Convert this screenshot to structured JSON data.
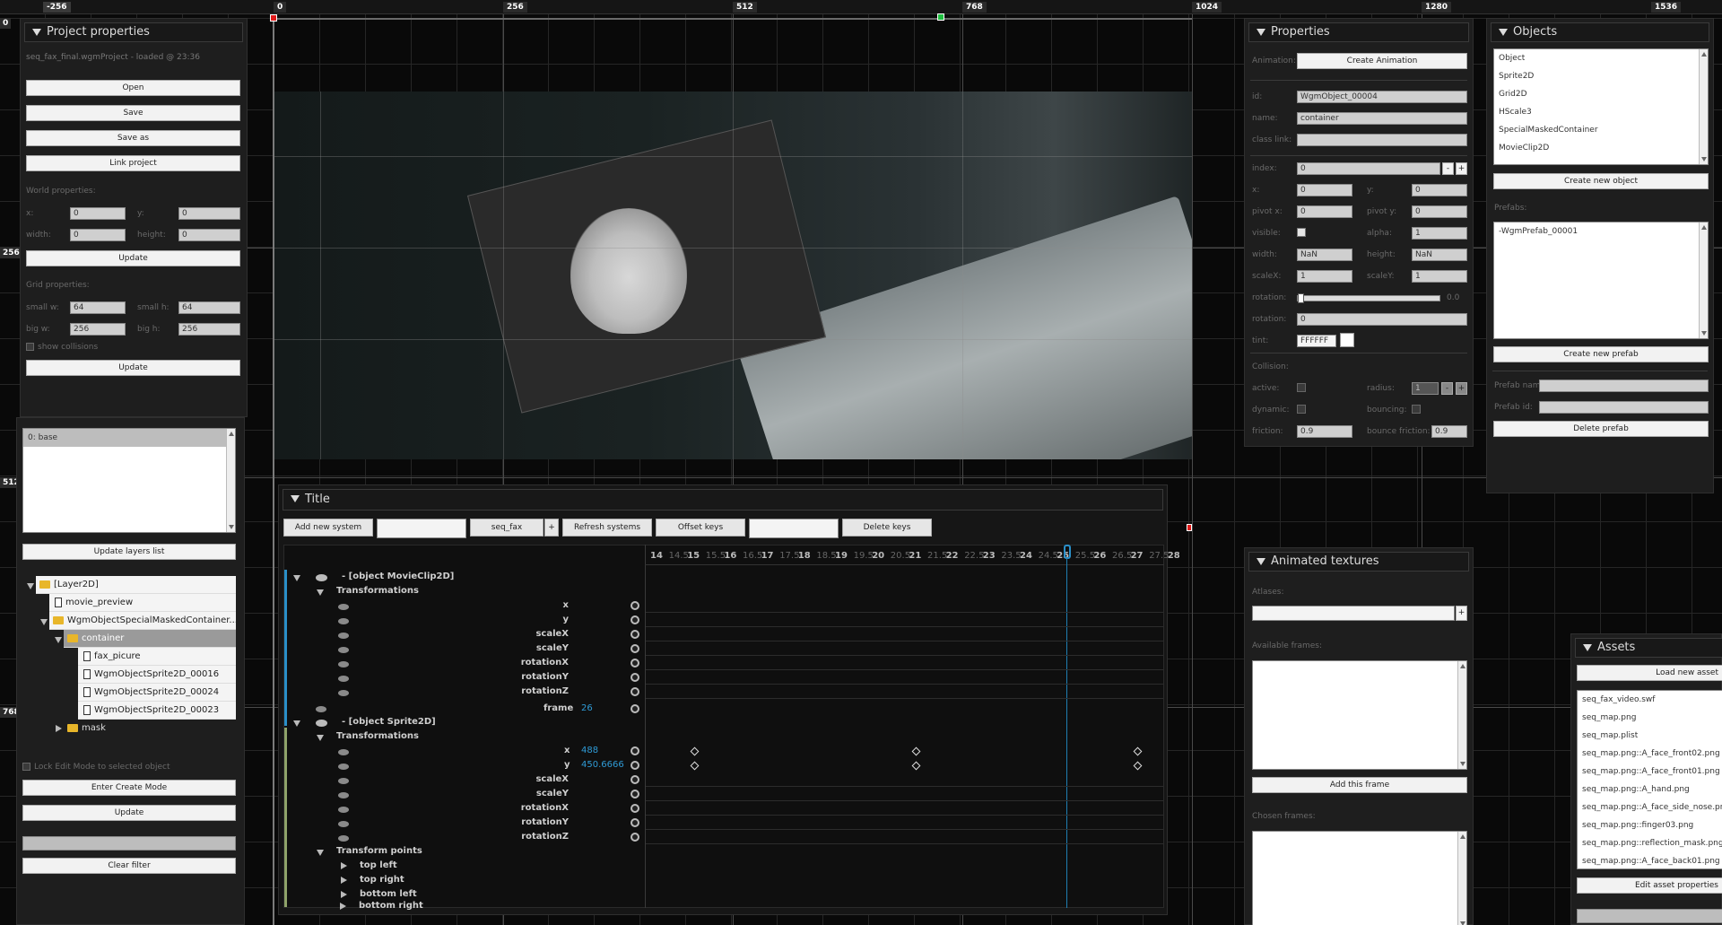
{
  "rulers": {
    "top": [
      "-256",
      "0",
      "256",
      "512",
      "768",
      "1024",
      "1280",
      "1536"
    ],
    "left": [
      "0",
      "256",
      "512",
      "768"
    ]
  },
  "project": {
    "title": "Project properties",
    "status": "seq_fax_final.wgmProject - loaded @ 23:36",
    "open": "Open",
    "save": "Save",
    "save_as": "Save as",
    "link_project": "Link project",
    "world_label": "World properties:",
    "x_label": "x:",
    "x": "0",
    "y_label": "y:",
    "y": "0",
    "width_label": "width:",
    "width": "0",
    "height_label": "height:",
    "height": "0",
    "update": "Update",
    "grid_label": "Grid properties:",
    "small_w_label": "small w:",
    "small_w": "64",
    "small_h_label": "small h:",
    "small_h": "64",
    "big_w_label": "big w:",
    "big_w": "256",
    "big_h_label": "big h:",
    "big_h": "256",
    "show_collisions": "show collisions",
    "update2": "Update"
  },
  "layers": {
    "items": [
      "0: base"
    ],
    "update_layers": "Update layers list"
  },
  "tree": {
    "rows": [
      "[Layer2D]",
      "movie_preview",
      "WgmObjectSpecialMaskedContainer...",
      "container",
      "fax_picure",
      "WgmObjectSprite2D_00016",
      "WgmObjectSprite2D_00024",
      "WgmObjectSprite2D_00023",
      "mask"
    ],
    "lock_edit": "Lock Edit Mode to selected object",
    "enter_create": "Enter Create Mode",
    "update": "Update",
    "clear_filter": "Clear filter"
  },
  "properties": {
    "title": "Properties",
    "animation_label": "Animation:",
    "create_animation": "Create Animation",
    "id_label": "id:",
    "id": "WgmObject_00004",
    "name_label": "name:",
    "name": "container",
    "class_label": "class link:",
    "index_label": "index:",
    "index": "0",
    "x_label": "x:",
    "x": "0",
    "y_label": "y:",
    "y": "0",
    "pivotx_label": "pivot x:",
    "pivotx": "0",
    "pivoty_label": "pivot y:",
    "pivoty": "0",
    "visible_label": "visible:",
    "alpha_label": "alpha:",
    "alpha": "1",
    "width_label": "width:",
    "width": "NaN",
    "height_label": "height:",
    "height": "NaN",
    "scalex_label": "scaleX:",
    "scalex": "1",
    "scaley_label": "scaleY:",
    "scaley": "1",
    "rotation_label": "rotation:",
    "rotation_slider": "0.0",
    "rotation2_label": "rotation:",
    "rotation": "0",
    "tint_label": "tint:",
    "tint": "FFFFFF",
    "collision_label": "Collision:",
    "active_label": "active:",
    "radius_label": "radius:",
    "radius": "1",
    "dynamic_label": "dynamic:",
    "bouncing_label": "bouncing:",
    "friction_label": "friction:",
    "friction": "0.9",
    "bounce_friction_label": "bounce friction:",
    "bounce_friction": "0.9"
  },
  "objects": {
    "title": "Objects",
    "items": [
      "Object",
      "Sprite2D",
      "Grid2D",
      "HScale3",
      "SpecialMaskedContainer",
      "MovieClip2D"
    ],
    "create_object": "Create new object",
    "prefabs_label": "Prefabs:",
    "prefabs": [
      "-WgmPrefab_00001"
    ],
    "create_prefab": "Create new prefab",
    "prefab_name_label": "Prefab nam",
    "prefab_id_label": "Prefab id:",
    "delete_prefab": "Delete prefab"
  },
  "animated": {
    "title": "Animated textures",
    "atlases_label": "Atlases:",
    "available_label": "Available frames:",
    "add_frame": "Add this frame",
    "chosen_label": "Chosen frames:"
  },
  "assets": {
    "title": "Assets",
    "load": "Load new asset",
    "items": [
      "seq_fax_video.swf",
      "seq_map.png",
      "seq_map.plist",
      "seq_map.png::A_face_front02.png",
      "seq_map.png::A_face_front01.png",
      "seq_map.png::A_hand.png",
      "seq_map.png::A_face_side_nose.png",
      "seq_map.png::finger03.png",
      "seq_map.png::reflection_mask.png",
      "seq_map.png::A_face_back01.png"
    ],
    "edit": "Edit asset properties"
  },
  "timeline": {
    "title": "Title",
    "add_system": "Add new system",
    "system_select": "seq_fax",
    "plus": "+",
    "refresh": "Refresh systems",
    "offset": "Offset keys",
    "delete_keys": "Delete keys",
    "ticks": [
      "14",
      "14.5",
      "15",
      "15.5",
      "16",
      "16.5",
      "17",
      "17.5",
      "18",
      "18.5",
      "19",
      "19.5",
      "20",
      "20.5",
      "21",
      "21.5",
      "22",
      "22.5",
      "23",
      "23.5",
      "24",
      "24.5",
      "25",
      "25.5",
      "26",
      "26.5",
      "27",
      "27.5",
      "28"
    ],
    "obj1": "- [object MovieClip2D]",
    "transformations": "Transformations",
    "tracks1": [
      "x",
      "y",
      "scaleX",
      "scaleY",
      "rotationX",
      "rotationY",
      "rotationZ"
    ],
    "frame_label": "frame",
    "frame_value": "26",
    "obj2": "- [object Sprite2D]",
    "transformations2": "Transformations",
    "x_label": "x",
    "x_value": "488",
    "y_label": "y",
    "y_value": "450.6666",
    "tracks2": [
      "scaleX",
      "scaleY",
      "rotationX",
      "rotationY",
      "rotationZ"
    ],
    "transform_points": "Transform points",
    "points": [
      "top left",
      "top right",
      "bottom left",
      "bottom right"
    ]
  }
}
